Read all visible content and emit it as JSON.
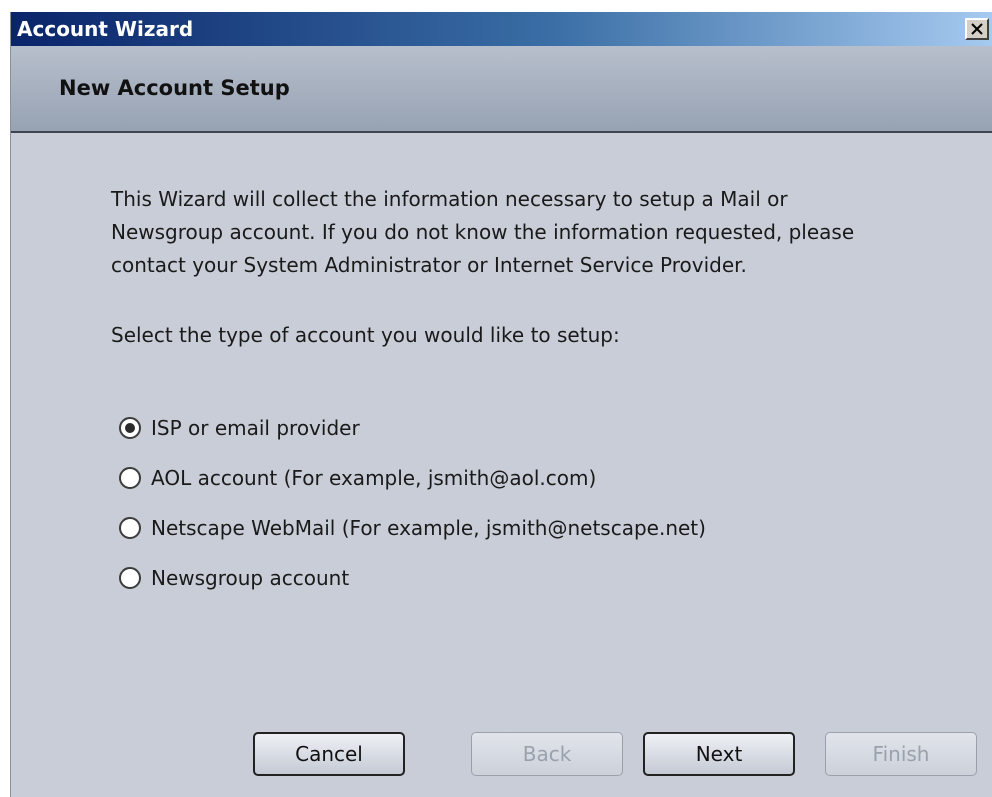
{
  "window": {
    "title": "Account Wizard",
    "close_symbol": "✕"
  },
  "header": {
    "title": "New Account Setup"
  },
  "content": {
    "intro": "This Wizard will collect the information necessary to setup a Mail or Newsgroup account. If you do not know the information requested, please contact your System Administrator or Internet Service Provider.",
    "prompt": "Select the type of account you would like to setup:",
    "options": [
      {
        "label": "ISP or email provider",
        "selected": true
      },
      {
        "label": "AOL account (For example, jsmith@aol.com)",
        "selected": false
      },
      {
        "label": "Netscape WebMail (For example, jsmith@netscape.net)",
        "selected": false
      },
      {
        "label": "Newsgroup account",
        "selected": false
      }
    ]
  },
  "buttons": {
    "cancel": {
      "label": "Cancel",
      "enabled": true
    },
    "back": {
      "label": "Back",
      "enabled": false
    },
    "next": {
      "label": "Next",
      "enabled": true
    },
    "finish": {
      "label": "Finish",
      "enabled": false
    }
  },
  "colors": {
    "title_bar_start": "#0a246a",
    "title_bar_end": "#a6caf0",
    "window_bg": "#c8cdd7",
    "header_bg": "#a7b0bf"
  },
  "icons": {
    "close": "close-icon",
    "radio_selected": "radio-selected-icon",
    "radio_unselected": "radio-unselected-icon"
  }
}
